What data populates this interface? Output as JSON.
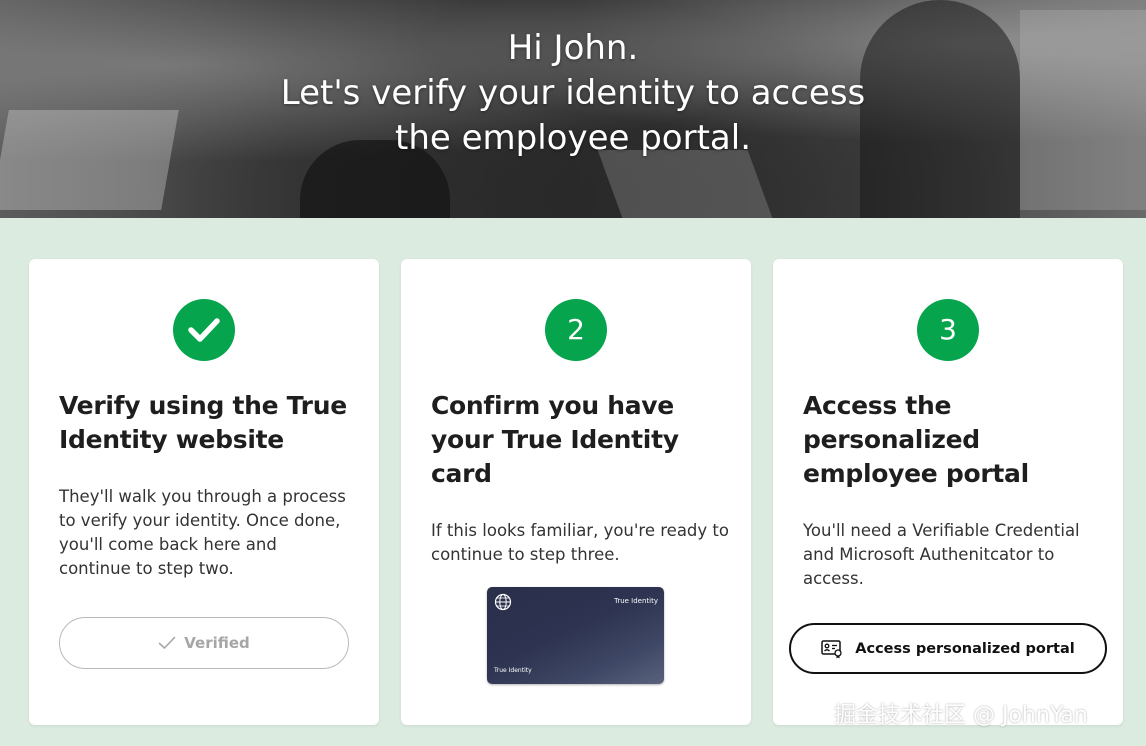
{
  "hero": {
    "line1": "Hi John.",
    "line2": "Let's verify your identity to access",
    "line3": "the employee portal."
  },
  "steps": [
    {
      "badge_icon": "checkmark-icon",
      "title_line1": "Verify using the True",
      "title_line2": "Identity website",
      "description": "They'll walk you through a process to verify your identity. Once done, you'll come back here and continue to step two.",
      "button_icon": "check-icon",
      "button_label": "Verified"
    },
    {
      "badge": "2",
      "title_line1": "Confirm you have",
      "title_line2": "your True Identity",
      "title_line3": "card",
      "description": "If this looks familiar, you're ready to continue to step three.",
      "card_image": {
        "icon": "globe-icon",
        "top_right_text": "True Identity",
        "bottom_left_text": "True Identity"
      }
    },
    {
      "badge": "3",
      "title_line1": "Access the",
      "title_line2": "personalized",
      "title_line3": "employee portal",
      "description": "You'll need a Verifiable Credential and Microsoft Authenitcator to access.",
      "button_icon": "credential-badge-icon",
      "button_label": "Access personalized portal"
    }
  ],
  "watermark": "掘金技术社区 @ JohnYan",
  "colors": {
    "accent_green": "#05a44d",
    "page_background": "#dcebe0",
    "card_dark": "#2d3350"
  }
}
